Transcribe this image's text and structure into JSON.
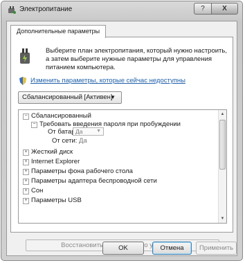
{
  "window": {
    "title": "Электропитание",
    "help_label": "?",
    "close_label": "X"
  },
  "tab": {
    "label": "Дополнительные параметры"
  },
  "description": "Выберите план электропитания, который нужно настроить, а затем выберите нужные параметры для управления питанием компьютера.",
  "change_link": "Изменить параметры, которые сейчас недоступны",
  "plan_select": {
    "value": "Сбалансированный [Активен]"
  },
  "tree": {
    "root": "Сбалансированный",
    "password_item": "Требовать введения пароля при пробуждении",
    "on_battery_label": "От батареи:",
    "on_battery_value": "Да",
    "on_ac_label": "От сети:",
    "on_ac_value": "Да",
    "items": [
      "Жесткий диск",
      "Internet Explorer",
      "Параметры фона рабочего стола",
      "Параметры адаптера беспроводной сети",
      "Сон",
      "Параметры USB"
    ]
  },
  "restore_button": "Восстановить параметры по умолчанию",
  "buttons": {
    "ok": "OK",
    "cancel": "Отмена",
    "apply": "Применить"
  }
}
